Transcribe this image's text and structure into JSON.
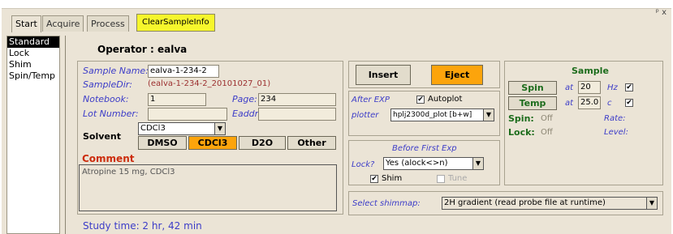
{
  "tabs": [
    "Start",
    "Acquire",
    "Process"
  ],
  "clear_button": "ClearSampleInfo",
  "pin_icon": "ᵖ",
  "close_x": "x",
  "left_items": [
    "Standard",
    "Lock",
    "Shim",
    "Spin/Temp"
  ],
  "operator_label": "Operator : ealva",
  "sample_info": {
    "sample_name_label": "Sample Name:",
    "sample_name": "ealva-1-234-2",
    "sample_dir_label": "SampleDir:",
    "sample_dir": "(ealva-1-234-2_20101027_01)",
    "notebook_label": "Notebook:",
    "notebook": "1",
    "page_label": "Page:",
    "page": "234",
    "lot_label": "Lot Number:",
    "lot": "",
    "eaddr_label": "Eaddr",
    "eaddr": ""
  },
  "solvent": {
    "label": "Solvent",
    "selected": "CDCl3",
    "buttons": [
      "DMSO",
      "CDCl3",
      "D2O",
      "Other"
    ]
  },
  "comment": {
    "label": "Comment",
    "text": "Atropine 15 mg, CDCl3"
  },
  "study_time": "Study time: 2 hr, 42 min",
  "insert_label": "Insert",
  "eject_label": "Eject",
  "after_exp_label": "After EXP",
  "autoplot_label": "Autoplot",
  "plotter_label": "plotter",
  "plotter_value": "hplj2300d_plot [b+w]",
  "before_first_exp_label": "Before First Exp",
  "lock_q_label": "Lock?",
  "lock_value": "Yes (alock<>n)",
  "shim_label": "Shim",
  "tune_label": "Tune",
  "sample_title": "Sample",
  "spin_button": "Spin",
  "temp_button": "Temp",
  "at_label": "at",
  "spin_value": "20",
  "hz_label": "Hz",
  "temp_value": "25.0",
  "c_label": "c",
  "spin_status_label": "Spin:",
  "spin_status": "Off",
  "rate_label": "Rate:",
  "lock_status_label": "Lock:",
  "lock_status": "Off",
  "level_label": "Level:",
  "shimmap_label": "Select shimmap:",
  "shimmap_value": "2H gradient (read probe file at runtime)",
  "colors": {
    "frame": "#ebe4d6",
    "accent_orange": "#fca40c",
    "accent_yellow": "#f6f62c",
    "label_blue": "#3c3cc8",
    "status_green": "#1c6c1c"
  }
}
